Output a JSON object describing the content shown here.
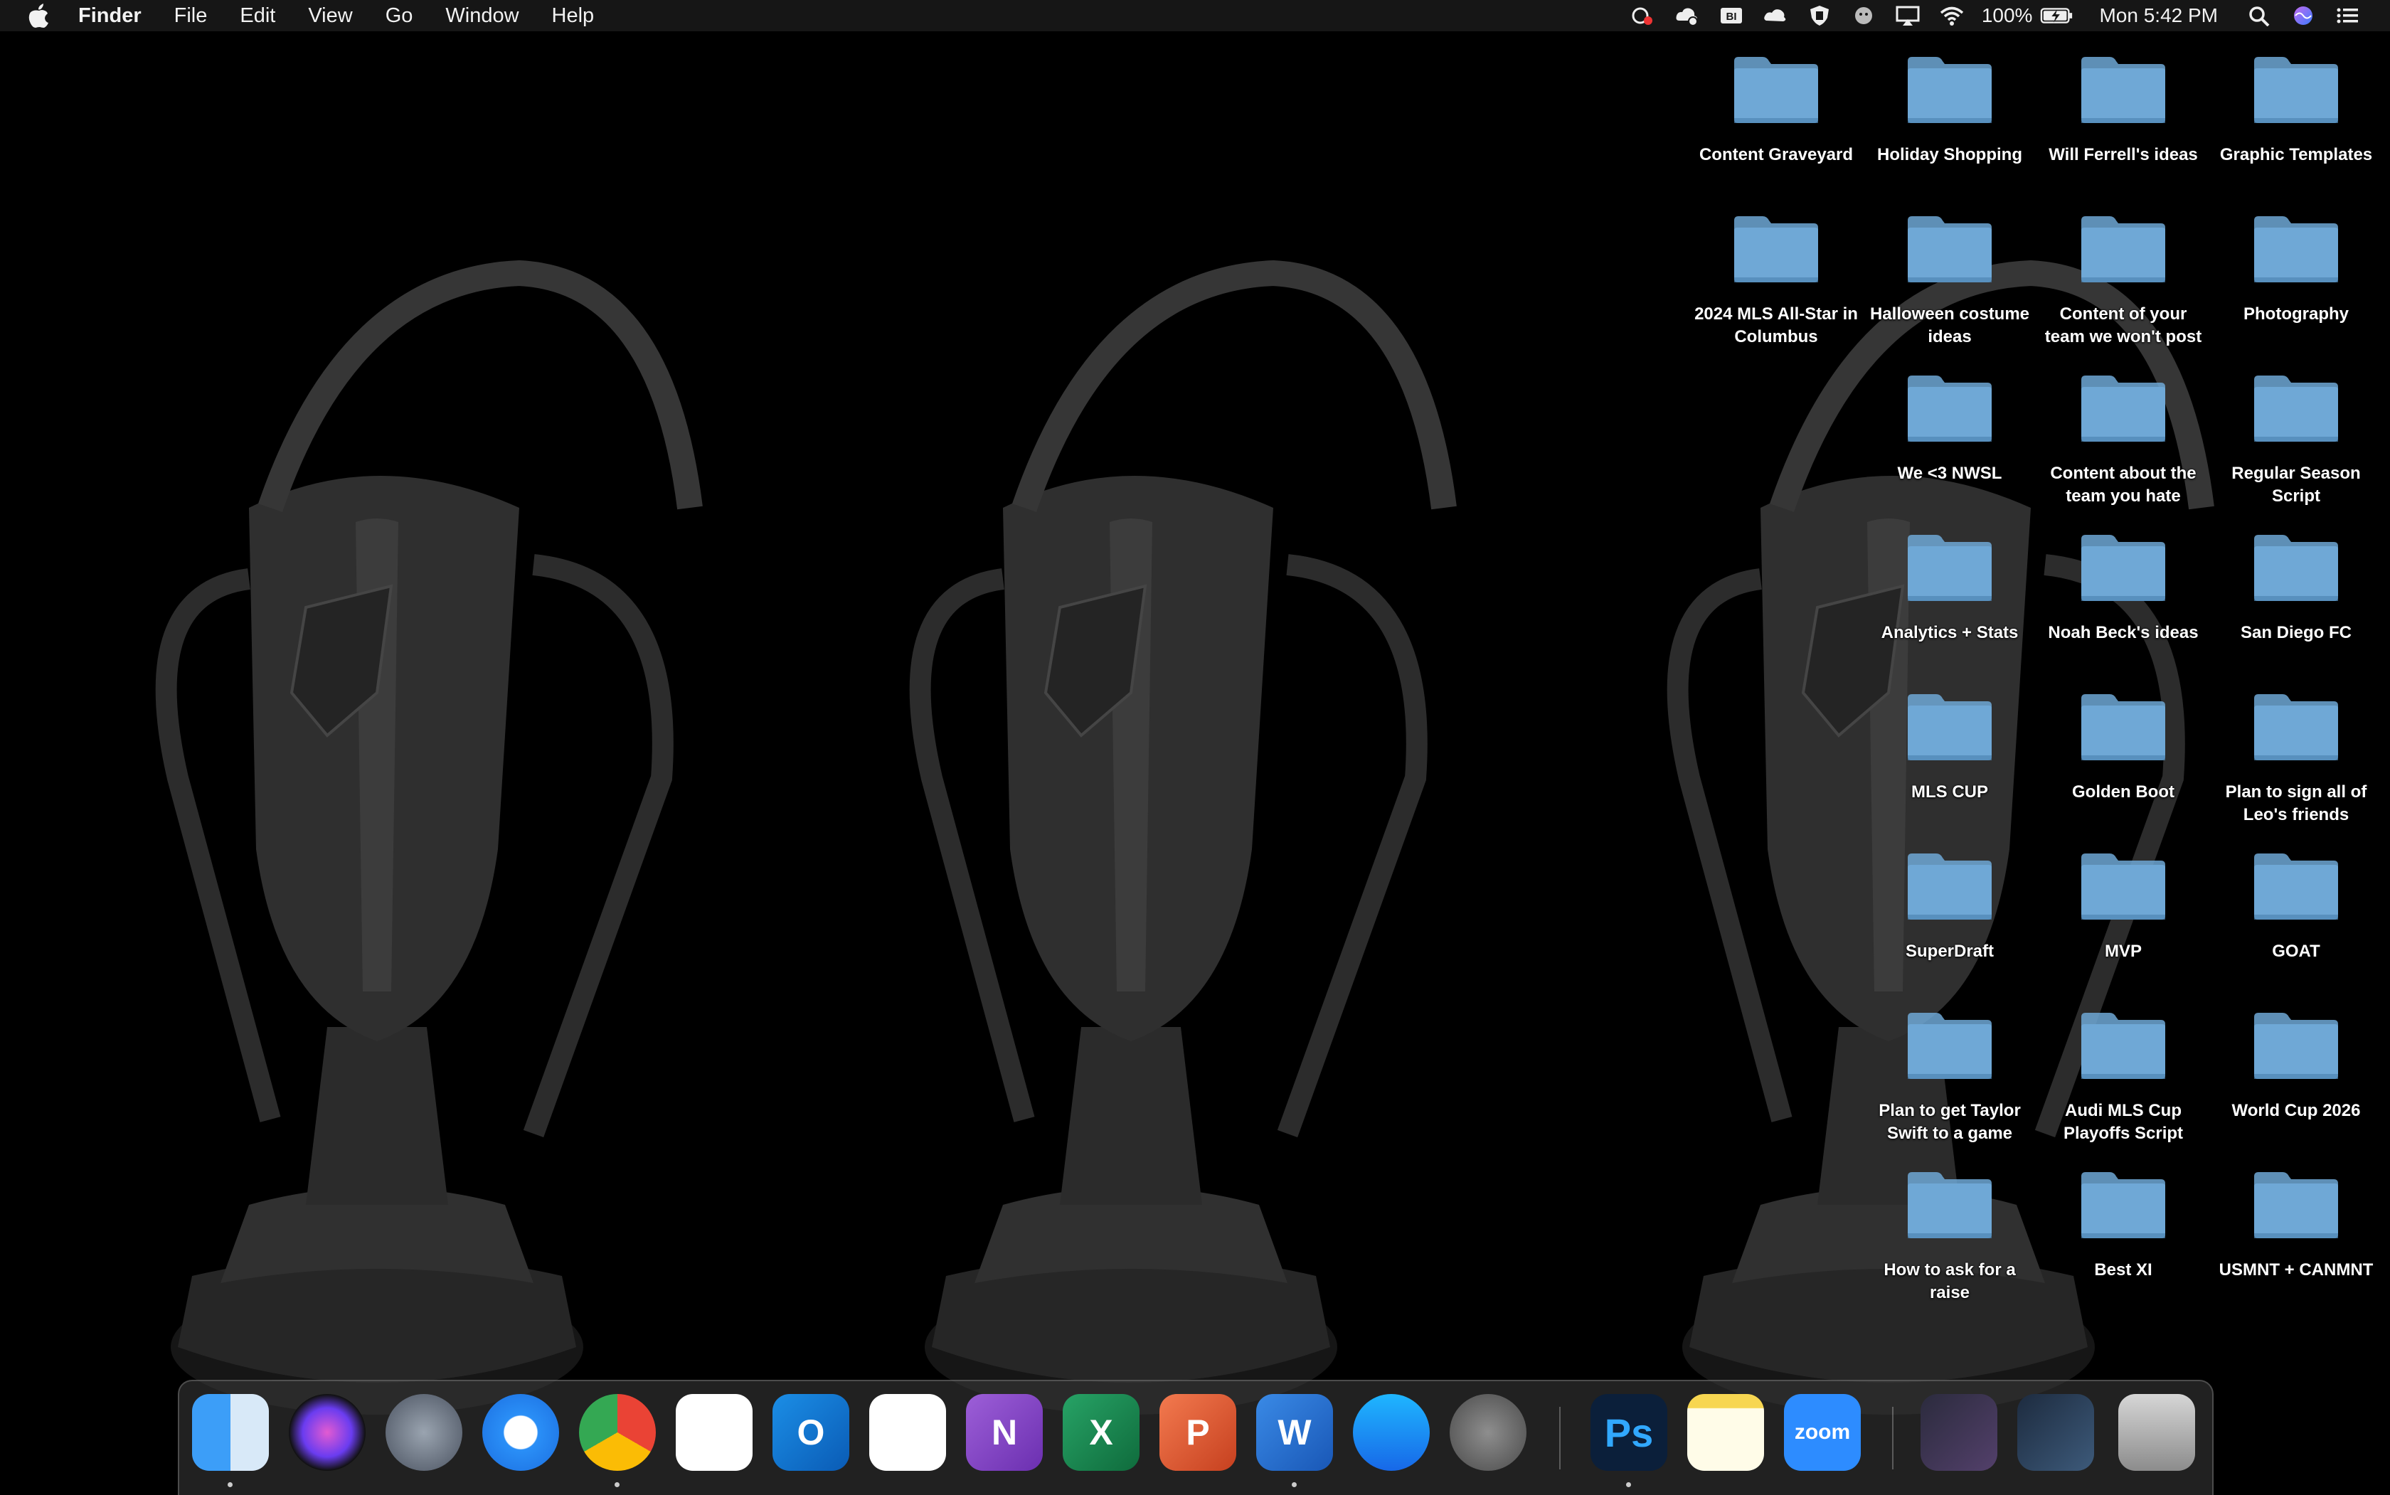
{
  "menubar": {
    "app_name": "Finder",
    "menus": [
      "File",
      "Edit",
      "View",
      "Go",
      "Window",
      "Help"
    ],
    "status_icons": [
      "creative-cloud-icon",
      "cloud-sync-icon",
      "bi-icon",
      "cloud-icon",
      "shield-icon",
      "ghost-icon",
      "airplay-icon",
      "wifi-icon"
    ],
    "battery_percent": "100%",
    "clock": "Mon 5:42 PM"
  },
  "desktop": {
    "folders": [
      {
        "label": "Content Graveyard",
        "col": 0,
        "row": 0
      },
      {
        "label": "Holiday Shopping",
        "col": 1,
        "row": 0
      },
      {
        "label": "Will Ferrell's ideas",
        "col": 2,
        "row": 0
      },
      {
        "label": "Graphic Templates",
        "col": 3,
        "row": 0
      },
      {
        "label": "2024 MLS All-Star in Columbus",
        "col": 0,
        "row": 1
      },
      {
        "label": "Halloween costume ideas",
        "col": 1,
        "row": 1
      },
      {
        "label": "Content of your team we won't post",
        "col": 2,
        "row": 1
      },
      {
        "label": "Photography",
        "col": 3,
        "row": 1
      },
      {
        "label": "We <3 NWSL",
        "col": 1,
        "row": 2
      },
      {
        "label": "Content about the team you hate",
        "col": 2,
        "row": 2
      },
      {
        "label": "Regular Season Script",
        "col": 3,
        "row": 2
      },
      {
        "label": "Analytics + Stats",
        "col": 1,
        "row": 3
      },
      {
        "label": "Noah Beck's ideas",
        "col": 2,
        "row": 3
      },
      {
        "label": "San Diego FC",
        "col": 3,
        "row": 3
      },
      {
        "label": "MLS CUP",
        "col": 1,
        "row": 4
      },
      {
        "label": "Golden Boot",
        "col": 2,
        "row": 4
      },
      {
        "label": "Plan to sign all of Leo's friends",
        "col": 3,
        "row": 4
      },
      {
        "label": "SuperDraft",
        "col": 1,
        "row": 5
      },
      {
        "label": "MVP",
        "col": 2,
        "row": 5
      },
      {
        "label": "GOAT",
        "col": 3,
        "row": 5
      },
      {
        "label": "Plan to get Taylor Swift to a game",
        "col": 1,
        "row": 6
      },
      {
        "label": "Audi MLS Cup Playoffs Script",
        "col": 2,
        "row": 6
      },
      {
        "label": "World Cup 2026",
        "col": 3,
        "row": 6
      },
      {
        "label": "How to ask for a raise",
        "col": 1,
        "row": 7
      },
      {
        "label": "Best XI",
        "col": 2,
        "row": 7
      },
      {
        "label": "USMNT + CANMNT",
        "col": 3,
        "row": 7
      }
    ],
    "folder_color": "#6fa8d6"
  },
  "dock": {
    "apps": [
      {
        "name": "finder",
        "glyph": "",
        "running": true
      },
      {
        "name": "siri",
        "glyph": "",
        "running": false
      },
      {
        "name": "launchpad",
        "glyph": "",
        "running": false
      },
      {
        "name": "safari",
        "glyph": "",
        "running": false
      },
      {
        "name": "chrome",
        "glyph": "",
        "running": true
      },
      {
        "name": "slack",
        "glyph": "",
        "running": false
      },
      {
        "name": "outlook",
        "glyph": "O",
        "running": false
      },
      {
        "name": "onedrive",
        "glyph": "",
        "running": false
      },
      {
        "name": "onenote",
        "glyph": "N",
        "running": false
      },
      {
        "name": "excel",
        "glyph": "X",
        "running": false
      },
      {
        "name": "powerpoint",
        "glyph": "P",
        "running": false
      },
      {
        "name": "word",
        "glyph": "W",
        "running": true
      },
      {
        "name": "app-store",
        "glyph": "",
        "running": false
      },
      {
        "name": "system-preferences",
        "glyph": "",
        "running": false
      },
      {
        "name": "photoshop",
        "glyph": "Ps",
        "running": true
      },
      {
        "name": "notes",
        "glyph": "",
        "running": false
      },
      {
        "name": "zoom",
        "glyph": "zoom",
        "running": false
      },
      {
        "name": "photoshop-window-thumbnail",
        "glyph": "",
        "running": false
      },
      {
        "name": "chrome-window-thumbnail",
        "glyph": "",
        "running": false
      },
      {
        "name": "trash",
        "glyph": "",
        "running": false
      }
    ]
  }
}
